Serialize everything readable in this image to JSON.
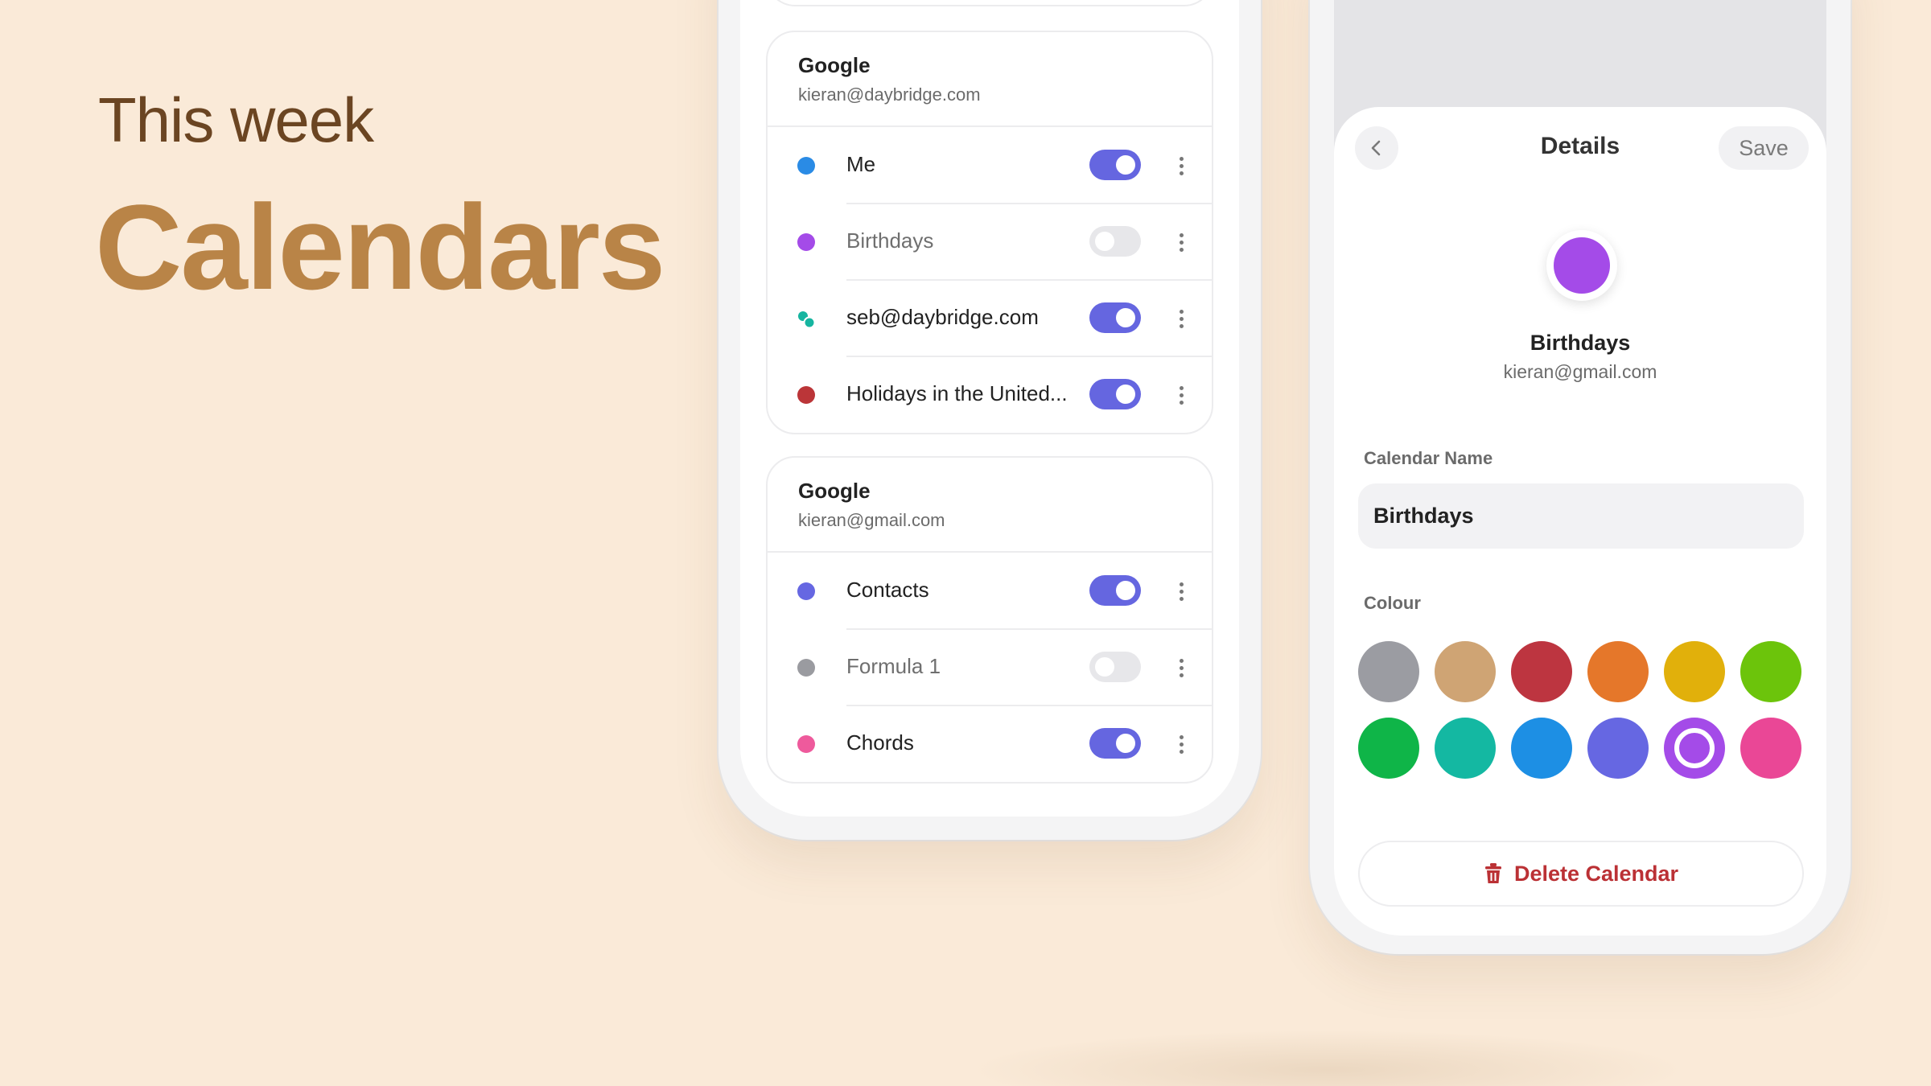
{
  "hero": {
    "kicker": "This week",
    "title": "Calendars"
  },
  "calendar_list": {
    "groups": [
      {
        "provider": "Google",
        "email": "kieran@daybridge.com",
        "calendars": [
          {
            "name": "Me",
            "color": "#2a8be5",
            "enabled": true
          },
          {
            "name": "Birthdays",
            "color": "#a44be8",
            "enabled": false
          },
          {
            "name": "seb@daybridge.com",
            "color": "#16b5a0",
            "enabled": true,
            "icon": "shared-calendar-icon"
          },
          {
            "name": "Holidays in the United...",
            "color": "#bb3538",
            "enabled": true
          }
        ]
      },
      {
        "provider": "Google",
        "email": "kieran@gmail.com",
        "calendars": [
          {
            "name": "Contacts",
            "color": "#6667e2",
            "enabled": true
          },
          {
            "name": "Formula 1",
            "color": "#9a9ba0",
            "enabled": false
          },
          {
            "name": "Chords",
            "color": "#ee5a9c",
            "enabled": true
          }
        ]
      }
    ]
  },
  "details": {
    "title": "Details",
    "back_icon": "chevron-left-icon",
    "save_label": "Save",
    "calendar_name": "Birthdays",
    "account_email": "kieran@gmail.com",
    "name_label": "Calendar Name",
    "name_value": "Birthdays",
    "colour_label": "Colour",
    "selected_colour": "#a44be8",
    "colours": [
      "#9b9ca2",
      "#cfa474",
      "#bd3540",
      "#e5772a",
      "#e1b00b",
      "#6cc40b",
      "#0fb548",
      "#14b8a2",
      "#1d8fe4",
      "#6667e2",
      "#a44be8",
      "#ea4796"
    ],
    "delete_label": "Delete Calendar",
    "delete_icon": "trash-icon"
  }
}
